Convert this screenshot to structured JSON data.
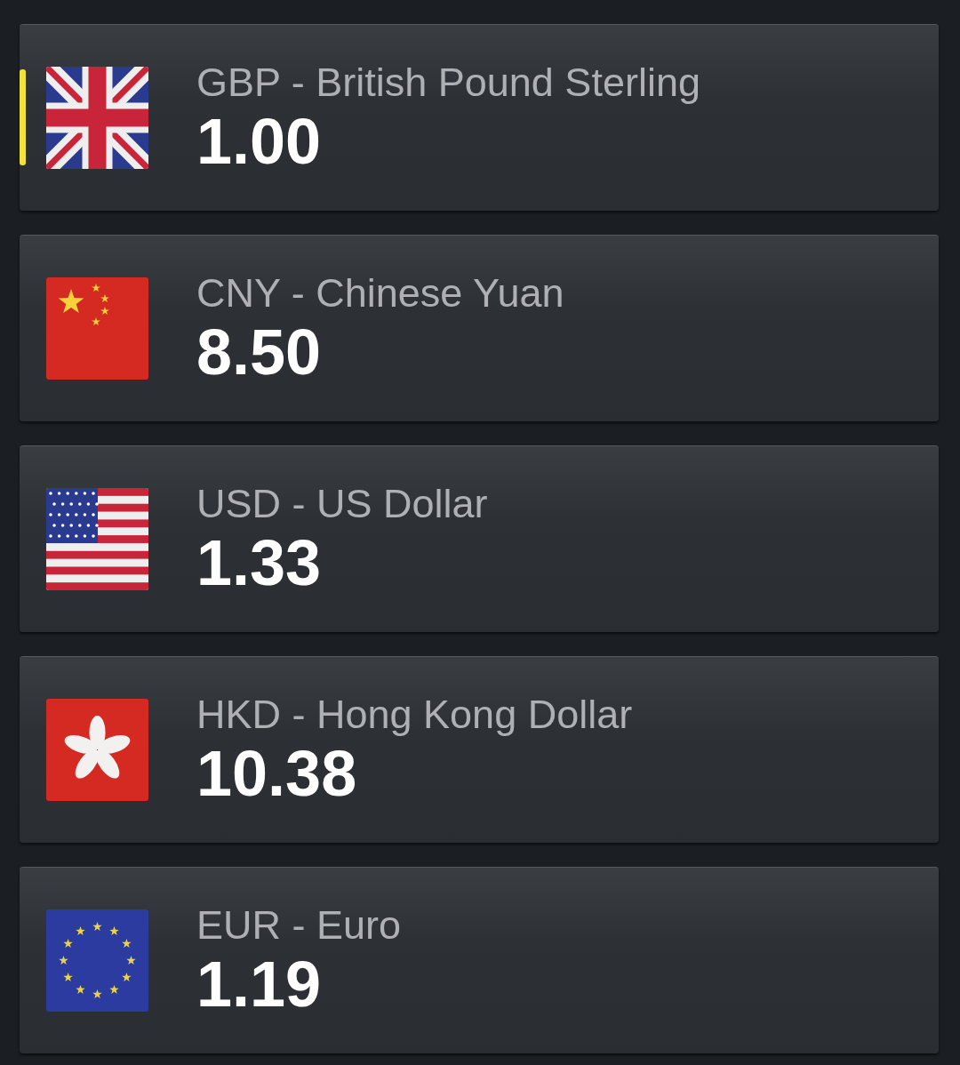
{
  "currencies": [
    {
      "kind": "gb",
      "name": "GBP - British Pound Sterling",
      "value": "1.00",
      "selected": true
    },
    {
      "kind": "cn",
      "name": "CNY - Chinese Yuan",
      "value": "8.50",
      "selected": false
    },
    {
      "kind": "us",
      "name": "USD - US Dollar",
      "value": "1.33",
      "selected": false
    },
    {
      "kind": "hk",
      "name": "HKD - Hong Kong Dollar",
      "value": "10.38",
      "selected": false
    },
    {
      "kind": "eu",
      "name": "EUR - Euro",
      "value": "1.19",
      "selected": false
    }
  ]
}
